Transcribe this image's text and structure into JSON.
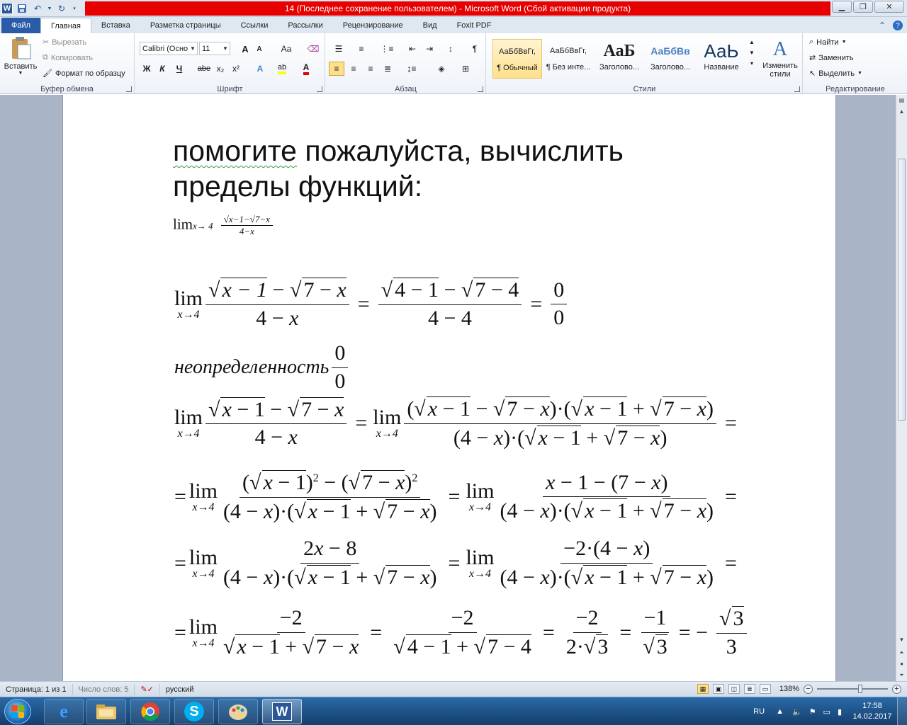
{
  "window": {
    "title": "14 (Последнее сохранение пользователем)  -  Microsoft Word (Сбой активации продукта)"
  },
  "quick_access": {
    "undo_glyph": "↶",
    "redo_glyph": "↻"
  },
  "tabs": [
    {
      "label": "Файл"
    },
    {
      "label": "Главная"
    },
    {
      "label": "Вставка"
    },
    {
      "label": "Разметка страницы"
    },
    {
      "label": "Ссылки"
    },
    {
      "label": "Рассылки"
    },
    {
      "label": "Рецензирование"
    },
    {
      "label": "Вид"
    },
    {
      "label": "Foxit PDF"
    }
  ],
  "ribbon": {
    "clipboard": {
      "paste": "Вставить",
      "cut": "Вырезать",
      "copy": "Копировать",
      "format_painter": "Формат по образцу",
      "group_label": "Буфер обмена"
    },
    "font": {
      "font_name": "Calibri (Осно",
      "font_size": "11",
      "bold": "Ж",
      "italic": "К",
      "underline": "Ч",
      "strike": "abe",
      "sub": "x₂",
      "sup": "x²",
      "grow": "A",
      "shrink": "A",
      "case": "Aa",
      "group_label": "Шрифт"
    },
    "paragraph": {
      "group_label": "Абзац",
      "pilcrow": "¶"
    },
    "styles": {
      "items": [
        {
          "preview": "АаБбВвГг,",
          "name": "¶ Обычный"
        },
        {
          "preview": "АаБбВвГг,",
          "name": "¶ Без инте..."
        },
        {
          "preview": "АаБ",
          "name": "Заголово..."
        },
        {
          "preview": "АаБбВв",
          "name": "Заголово..."
        },
        {
          "preview": "АаЬ",
          "name": "Название"
        }
      ],
      "change_styles": "Изменить стили",
      "group_label": "Стили"
    },
    "editing": {
      "find": "Найти",
      "replace": "Заменить",
      "select": "Выделить",
      "group_label": "Редактирование"
    }
  },
  "document": {
    "heading_part1": "помогите",
    "heading_part2": " пожалуйста, вычислить",
    "heading_line2": "пределы функций:",
    "small_formula": {
      "lim": "lim",
      "sub": "x→ 4",
      "num": "√x−1−√7−x",
      "den": "4−x"
    },
    "math": {
      "lim": "lim",
      "lim_sub": "x→4",
      "uncertainty_word": "неопределенность",
      "zero": "0"
    }
  },
  "status": {
    "page": "Страница: 1 из 1",
    "words": "Число слов: 5",
    "language": "русский",
    "zoom": "138%"
  },
  "taskbar": {
    "lang": "RU",
    "time": "17:58",
    "date": "14.02.2017"
  }
}
